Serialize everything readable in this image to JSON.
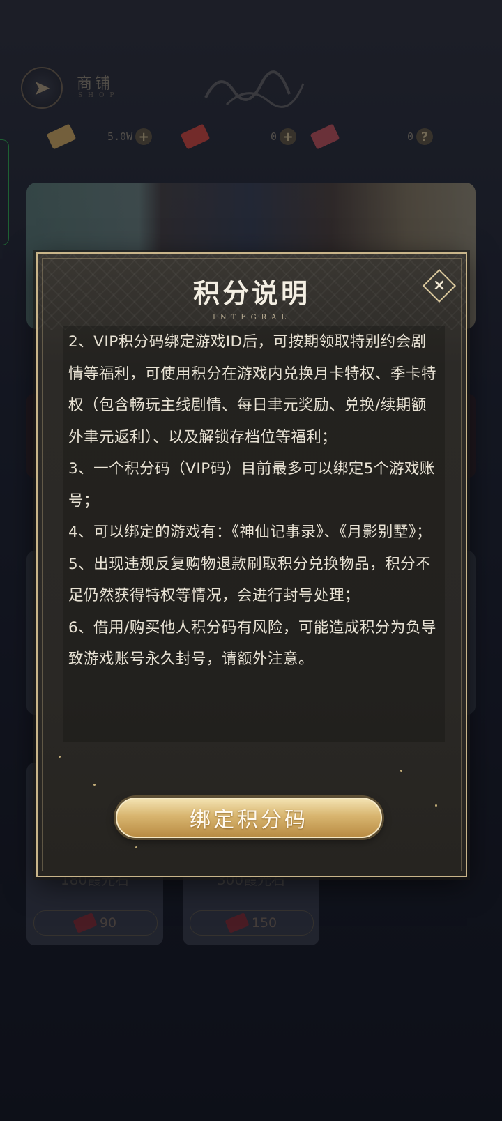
{
  "shop": {
    "title": "商铺",
    "subtitle": "SHOP",
    "currencies": [
      {
        "name": "ticket-gold",
        "value": "5.0W",
        "color": "#c9a45f"
      },
      {
        "name": "ticket-red",
        "value": "0",
        "color": "#c8453f"
      },
      {
        "name": "ticket-pink",
        "value": "0",
        "color": "#b8505a"
      }
    ],
    "cards": [
      {
        "title": "180霞光石",
        "price": "90"
      },
      {
        "title": "300霞光石",
        "price": "150"
      }
    ]
  },
  "modal": {
    "title": "积分说明",
    "subtitle": "INTEGRAL",
    "rules": [
      "2、VIP积分码绑定游戏ID后，可按期领取特别约会剧情等福利，可使用积分在游戏内兑换月卡特权、季卡特权（包含畅玩主线剧情、每日聿元奖励、兑换/续期额外聿元返利）、以及解锁存档位等福利；",
      "3、一个积分码（VIP码）目前最多可以绑定5个游戏账号；",
      "4、可以绑定的游戏有：《神仙记事录》、《月影别墅》；",
      "5、出现违规反复购物退款刷取积分兑换物品，积分不足仍然获得特权等情况，会进行封号处理；",
      "6、借用/购买他人积分码有风险，可能造成积分为负导致游戏账号永久封号，请额外注意。"
    ],
    "bind_button": "绑定积分码",
    "close_symbol": "×"
  },
  "colors": {
    "accent_gold": "#d8b56f",
    "modal_border": "#c9b58a",
    "text": "#e8e2d4"
  }
}
